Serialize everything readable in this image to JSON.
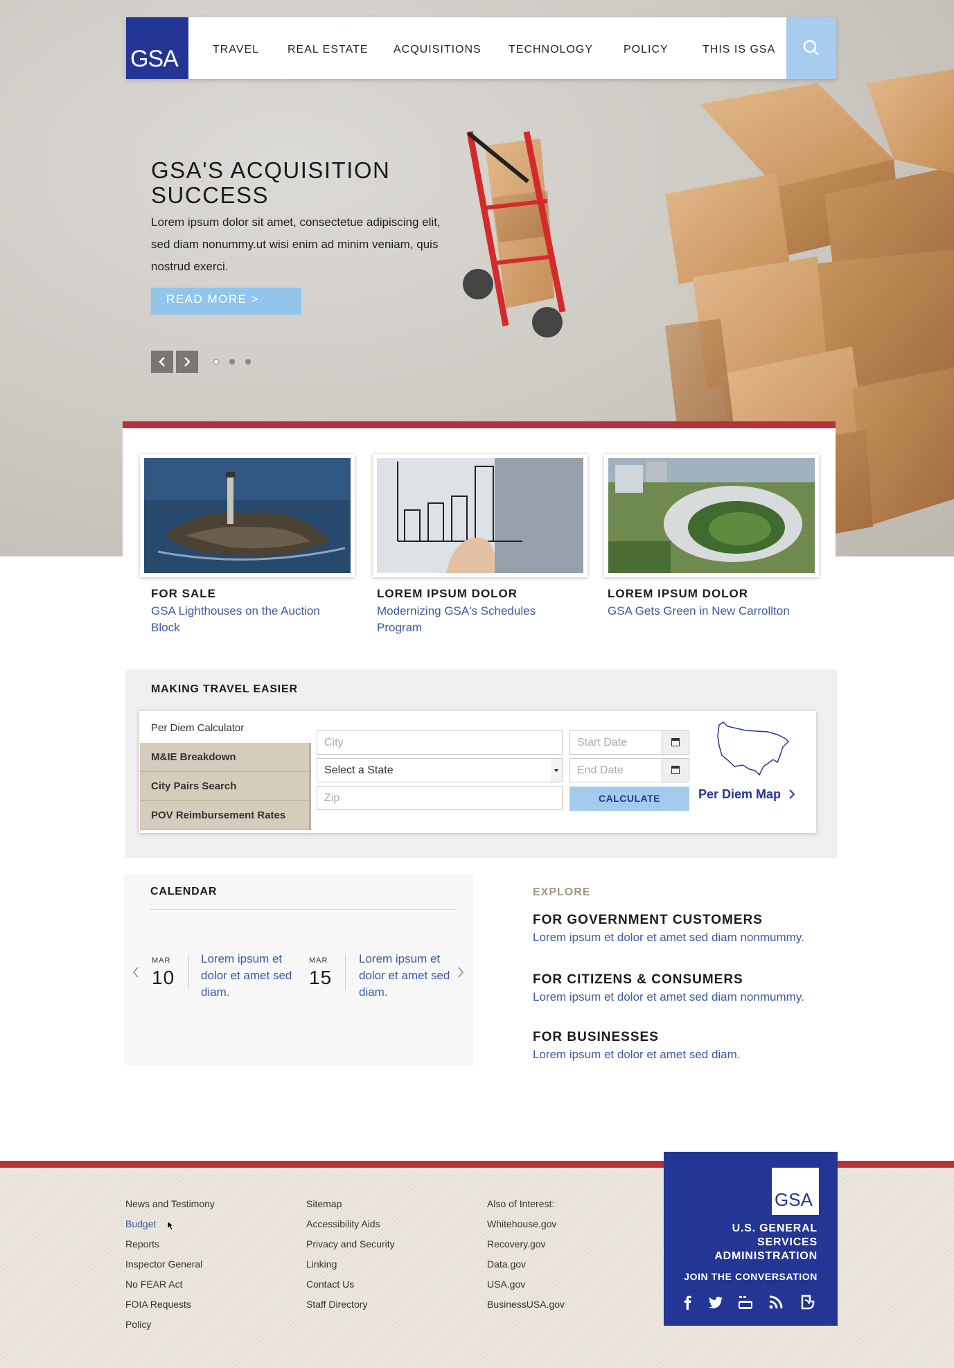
{
  "nav": {
    "logo": "GSA",
    "items": [
      "TRAVEL",
      "REAL ESTATE",
      "ACQUISITIONS",
      "TECHNOLOGY",
      "POLICY",
      "THIS IS GSA"
    ],
    "search_icon": "search-icon"
  },
  "hero": {
    "title": "GSA'S ACQUISITION SUCCESS",
    "body": "Lorem ipsum dolor sit amet, consectetue adipiscing elit, sed diam nonummy.ut wisi enim ad minim veniam, quis nostrud exerci.",
    "button": "READ MORE >",
    "slides": 3
  },
  "features": [
    {
      "category": "FOR SALE",
      "link": "GSA Lighthouses on the Auction Block"
    },
    {
      "category": "LOREM IPSUM DOLOR",
      "link": "Modernizing GSA's Schedules Program"
    },
    {
      "category": "LOREM IPSUM DOLOR",
      "link": "GSA Gets Green in New Carrollton"
    }
  ],
  "travel": {
    "title": "MAKING TRAVEL EASIER",
    "tabs": [
      "Per Diem Calculator",
      "M&IE Breakdown",
      "City Pairs Search",
      "POV Reimbursement Rates"
    ],
    "city_placeholder": "City",
    "state_select": "Select a State",
    "zip_placeholder": "Zip",
    "start_placeholder": "Start Date",
    "end_placeholder": "End Date",
    "calculate": "CALCULATE",
    "map_link": "Per Diem Map"
  },
  "calendar": {
    "title": "CALENDAR",
    "events": [
      {
        "month": "MAR",
        "day": "10",
        "text": "Lorem ipsum et dolor et amet sed diam."
      },
      {
        "month": "MAR",
        "day": "15",
        "text": "Lorem ipsum et dolor et amet sed diam."
      }
    ]
  },
  "explore": {
    "label": "EXPLORE",
    "items": [
      {
        "heading": "FOR GOVERNMENT CUSTOMERS",
        "text": "Lorem ipsum et dolor et amet sed diam nonmummy."
      },
      {
        "heading": "FOR CITIZENS & CONSUMERS",
        "text": "Lorem ipsum et dolor et amet sed diam nonmummy."
      },
      {
        "heading": "FOR BUSINESSES",
        "text": "Lorem ipsum et dolor et amet sed diam."
      }
    ]
  },
  "footer": {
    "col1": [
      "News and Testimony",
      "Budget",
      "Reports",
      "Inspector General",
      "No FEAR Act",
      "FOIA Requests",
      "Policy"
    ],
    "col2": [
      "Sitemap",
      "Accessibility Aids",
      "Privacy and Security",
      "Linking",
      "Contact Us",
      "Staff Directory"
    ],
    "col3_label": "Also of Interest:",
    "col3": [
      "Whitehouse.gov",
      "Recovery.gov",
      "Data.gov",
      "USA.gov",
      "BusinessUSA.gov"
    ],
    "agency": "U.S. GENERAL SERVICES ADMINISTRATION",
    "logo": "GSA",
    "join": "JOIN THE CONVERSATION",
    "social": [
      "facebook-icon",
      "twitter-icon",
      "youtube-icon",
      "rss-icon",
      "blog-icon"
    ]
  },
  "colors": {
    "brand_blue": "#233696",
    "accent_red": "#b5323b",
    "light_blue": "#a7cdee",
    "link_blue": "#3b5aa5"
  }
}
